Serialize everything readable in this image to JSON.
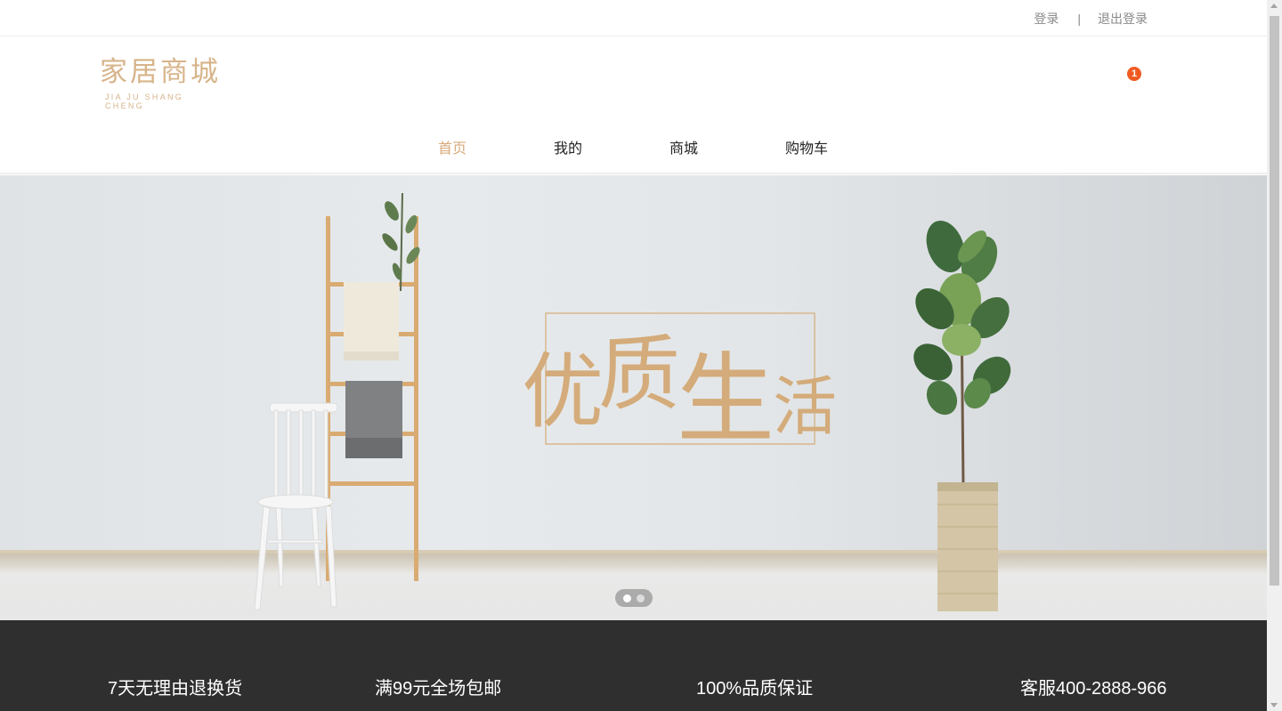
{
  "topbar": {
    "login_label": "登录",
    "separator": "|",
    "logout_label": "退出登录"
  },
  "logo": {
    "title": "家居商城",
    "subtitle": "JIA JU SHANG CHENG"
  },
  "cart": {
    "icon": "cart-icon",
    "count": "1"
  },
  "nav": {
    "items": [
      {
        "label": "首页",
        "active": true
      },
      {
        "label": "我的",
        "active": false
      },
      {
        "label": "商城",
        "active": false
      },
      {
        "label": "购物车",
        "active": false
      }
    ]
  },
  "banner": {
    "slogan": [
      "优",
      "质",
      "生",
      "活"
    ],
    "carousel": {
      "slide_count": 2,
      "current": 1
    }
  },
  "services": {
    "items": [
      "7天无理由退换货",
      "满99元全场包邮",
      "100%品质保证",
      "客服400-2888-966"
    ]
  },
  "colors": {
    "accent": "#d7a97a",
    "badge": "#f15a22",
    "footer_bg": "#2f2f2f"
  }
}
